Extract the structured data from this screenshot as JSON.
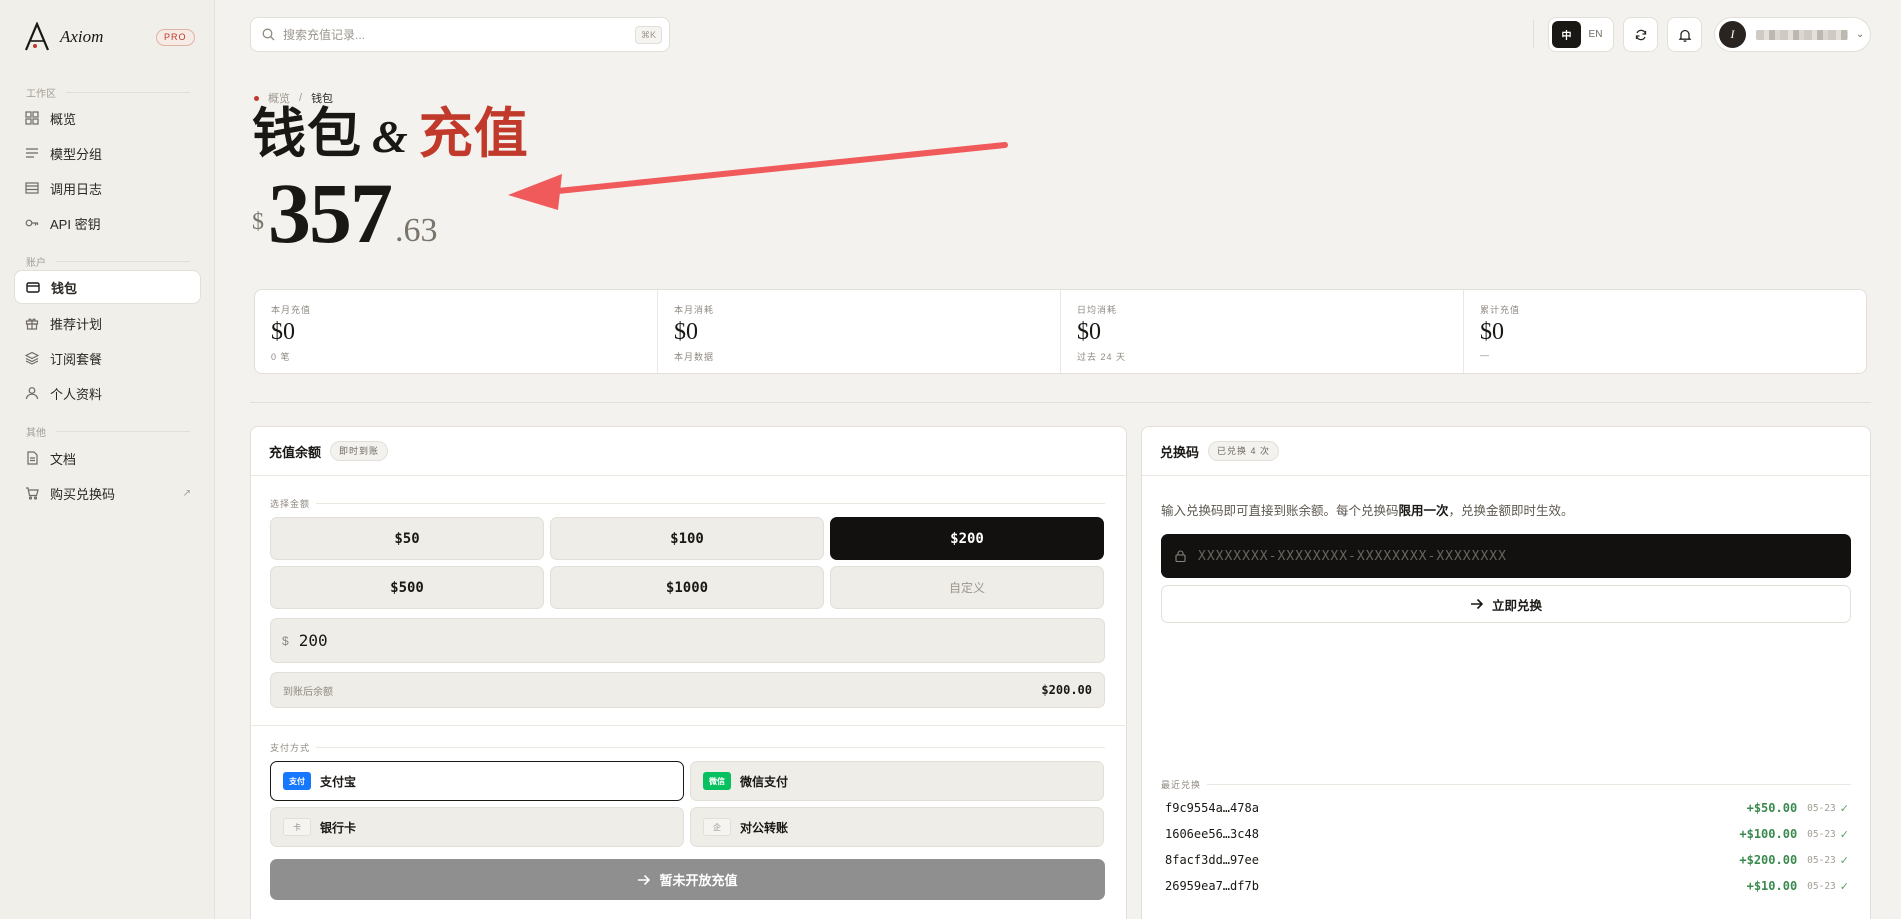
{
  "brand": {
    "name": "Axiom",
    "badge": "PRO"
  },
  "sidebar": {
    "sections": [
      {
        "label": "工作区"
      },
      {
        "label": "账户"
      },
      {
        "label": "其他"
      }
    ],
    "items": [
      {
        "label": "概览",
        "icon": "grid-icon"
      },
      {
        "label": "模型分组",
        "icon": "list-icon"
      },
      {
        "label": "调用日志",
        "icon": "table-icon"
      },
      {
        "label": "API 密钥",
        "icon": "key-icon"
      },
      {
        "label": "钱包",
        "icon": "wallet-icon",
        "active": true
      },
      {
        "label": "推荐计划",
        "icon": "gift-icon"
      },
      {
        "label": "订阅套餐",
        "icon": "layers-icon"
      },
      {
        "label": "个人资料",
        "icon": "user-icon"
      },
      {
        "label": "文档",
        "icon": "document-icon"
      },
      {
        "label": "购买兑换码",
        "icon": "cart-icon",
        "external": "↗"
      }
    ]
  },
  "topbar": {
    "search_placeholder": "搜索充值记录...",
    "shortcut": "⌘K",
    "lang": {
      "zh": "中",
      "en": "EN",
      "active": "zh"
    },
    "user_initial": "I",
    "chevron": "⌄"
  },
  "header": {
    "breadcrumb": {
      "parent": "概览",
      "sep": "/",
      "current": "钱包"
    },
    "title_a": "钱包",
    "title_amp": "&",
    "title_b": "充值",
    "balance": {
      "currency": "$",
      "integer": "357",
      "decimal": ".63"
    }
  },
  "stats": [
    {
      "label": "本月充值",
      "value": "$0",
      "sub": "0 笔"
    },
    {
      "label": "本月消耗",
      "value": "$0",
      "sub": "本月数据"
    },
    {
      "label": "日均消耗",
      "value": "$0",
      "sub": "过去 24 天"
    },
    {
      "label": "累计充值",
      "value": "$0",
      "sub": "—"
    }
  ],
  "topup": {
    "title": "充值余额",
    "badge": "即时到账",
    "amount_label": "选择金额",
    "amounts": [
      "$50",
      "$100",
      "$200",
      "$500",
      "$1000",
      "自定义"
    ],
    "selected_amount": "$200",
    "input_currency": "$",
    "input_value": "200",
    "after_label": "到账后余额",
    "after_value": "$200.00",
    "payment_label": "支付方式",
    "payments": [
      {
        "icon_text": "支付",
        "label": "支付宝",
        "selected": true
      },
      {
        "icon_text": "微信",
        "label": "微信支付"
      },
      {
        "icon_text": "卡",
        "label": "银行卡"
      },
      {
        "icon_text": "企",
        "label": "对公转账"
      }
    ],
    "submit_label": "暂未开放充值"
  },
  "redeem": {
    "title": "兑换码",
    "badge": "已兑换 4 次",
    "desc_a": "输入兑换码即可直接到账余额。每个兑换码",
    "desc_bold": "限用一次",
    "desc_b": "，兑换金额即时生效。",
    "placeholder": "XXXXXXXX-XXXXXXXX-XXXXXXXX-XXXXXXXX",
    "button_label": "立即兑换",
    "recent_label": "最近兑换",
    "recent": [
      {
        "code": "f9c9554a…478a",
        "amount": "+$50.00",
        "date": "05-23",
        "check": "✓"
      },
      {
        "code": "1606ee56…3c48",
        "amount": "+$100.00",
        "date": "05-23",
        "check": "✓"
      },
      {
        "code": "8facf3dd…97ee",
        "amount": "+$200.00",
        "date": "05-23",
        "check": "✓"
      },
      {
        "code": "26959ea7…df7b",
        "amount": "+$10.00",
        "date": "05-23",
        "check": "✓"
      }
    ]
  },
  "colors": {
    "accent": "#c0392b",
    "background": "#f4f2ee",
    "dark": "#121110",
    "positive": "#3a8a4e",
    "annotation_arrow": "#f05a5a"
  }
}
